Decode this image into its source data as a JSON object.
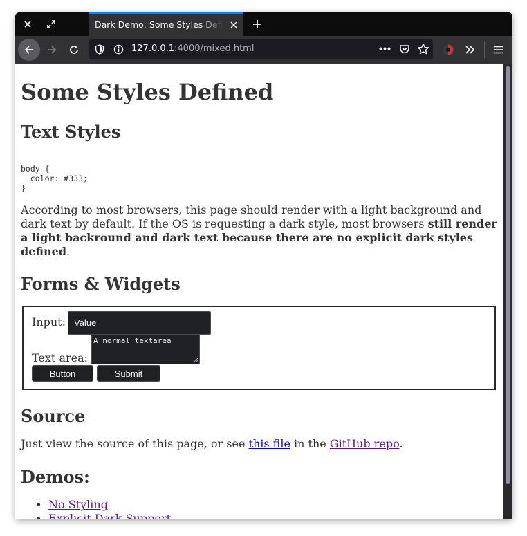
{
  "browser": {
    "tab_title": "Dark Demo: Some Styles Defined",
    "url_host": "127.0.0.1",
    "url_rest": ":4000/mixed.html"
  },
  "page": {
    "title": "Some Styles Defined",
    "text_styles_heading": "Text Styles",
    "code_lines": [
      "body {",
      "  color: #333;",
      "}"
    ],
    "desc_intro": "According to most browsers, this page should render with a light background and dark text by default. If the OS is requesting a dark style, most browsers ",
    "desc_bold": "still render a light backround and dark text because there are no explicit dark styles defined",
    "desc_end": ".",
    "forms_heading": "Forms & Widgets",
    "input_label": "Input:",
    "input_value": "Value",
    "textarea_label": "Text area:",
    "textarea_value": "A normal textarea",
    "button_label": "Button",
    "submit_label": "Submit",
    "source_heading": "Source",
    "source_pre": "Just view the source of this page, or see ",
    "source_link1": "this file",
    "source_mid": " in the ",
    "source_link2": "GitHub repo",
    "source_end": ".",
    "demos_heading": "Demos:",
    "demos": [
      "No Styling",
      "Explicit Dark Support"
    ]
  },
  "colors": {
    "text": "#333333",
    "link": "#0000ee",
    "visited_link": "#551a8b",
    "tab_accent": "#0a84ff",
    "widget_bg": "#202124"
  }
}
